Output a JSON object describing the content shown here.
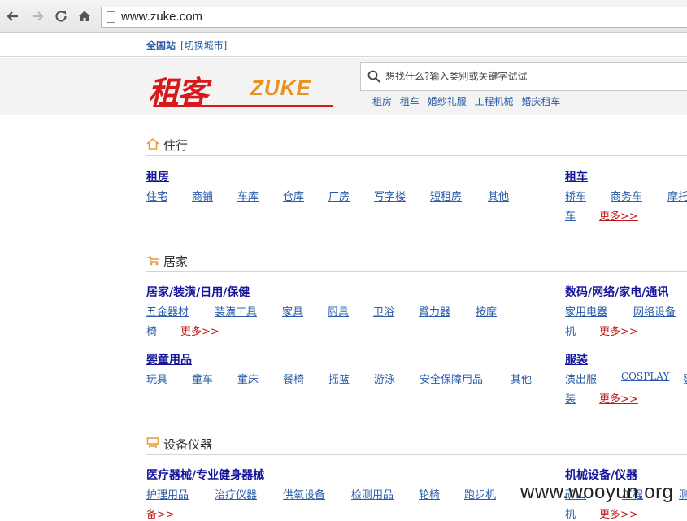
{
  "browser": {
    "url": "www.zuke.com",
    "icons": [
      "back-arrow-icon",
      "forward-arrow-icon",
      "reload-icon",
      "home-icon",
      "page-icon"
    ]
  },
  "topbar": {
    "city": "全国站",
    "switch_city": "[切换城市]"
  },
  "header": {
    "logo_cn": "租客",
    "logo_en": "ZUKE",
    "search_placeholder": "想找什么?输入类别或关键字试试",
    "hot_links": [
      "租房",
      "租车",
      "婚纱礼服",
      "工程机械",
      "婚庆租车"
    ]
  },
  "sections": {
    "zhuxing": {
      "title": "住行",
      "left": {
        "title": "租房",
        "row1": [
          "住宅",
          "商铺",
          "车库",
          "仓库",
          "厂房",
          "写字楼",
          "短租房",
          "其他"
        ]
      },
      "right": {
        "title": "租车",
        "row1": [
          "轿车",
          "商务车",
          "摩托"
        ],
        "row2_text": "车",
        "more": "更多>>"
      }
    },
    "jujia": {
      "title": "居家",
      "left1": {
        "title": "居家/装潢/日用/保健",
        "row1": [
          "五金器材",
          "装潢工具",
          "家具",
          "厨具",
          "卫浴",
          "臂力器",
          "按摩"
        ],
        "row2_text": "椅",
        "more": "更多>>"
      },
      "right1": {
        "title": "数码/网络/家电/通讯",
        "row1": [
          "家用电器",
          "网络设备"
        ],
        "row2_text": "机",
        "more": "更多>>"
      },
      "left2": {
        "title": "婴童用品",
        "row1": [
          "玩具",
          "童车",
          "童床",
          "餐椅",
          "摇篮",
          "游泳",
          "安全保障用品",
          "其他"
        ]
      },
      "right2": {
        "title": "服装",
        "row1": [
          "演出服",
          "COSPLAY",
          "婴"
        ],
        "row2_text": "装",
        "more": "更多>>"
      }
    },
    "shebei": {
      "title": "设备仪器",
      "left": {
        "title": "医疗器械/专业健身器械",
        "row1": [
          "护理用品",
          "治疗仪器",
          "供氧设备",
          "检测用品",
          "轮椅",
          "跑步机"
        ],
        "row2_text": "备>>"
      },
      "right": {
        "title": "机械设备/仪器",
        "row1": [
          "矿山",
          "工程",
          "测"
        ],
        "row2_text": "机",
        "more": "更多>>"
      }
    }
  },
  "watermark": "www.wooyun.org"
}
